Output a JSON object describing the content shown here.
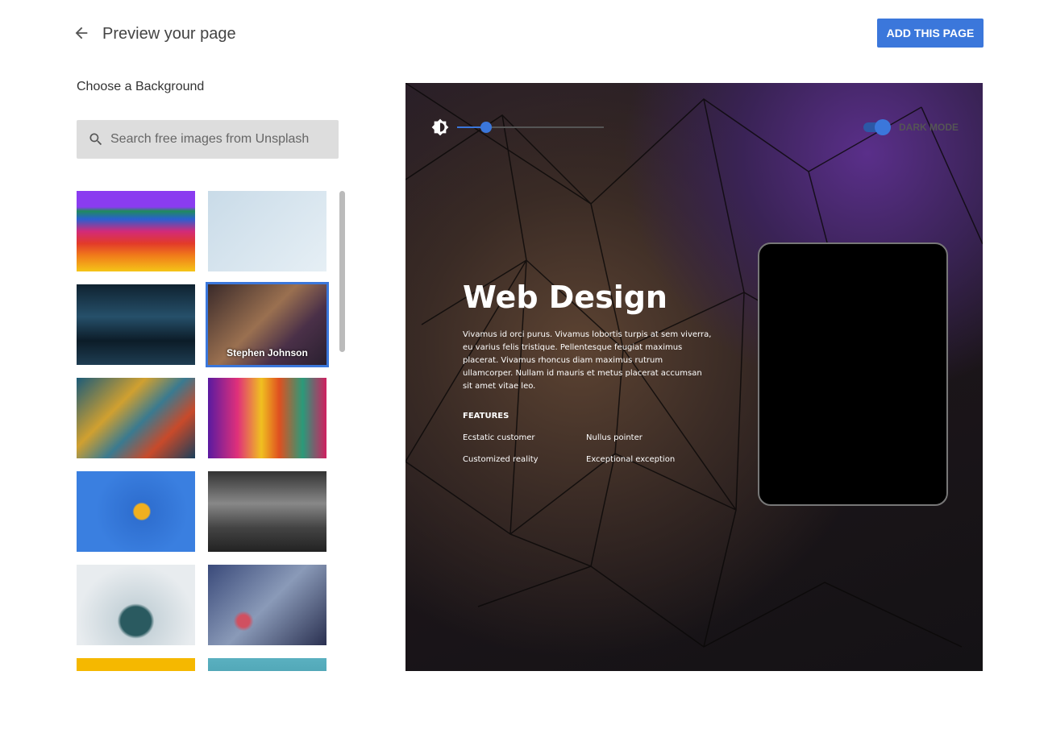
{
  "header": {
    "title": "Preview your page",
    "add_button": "ADD THIS PAGE"
  },
  "sidebar": {
    "heading": "Choose a Background",
    "search_placeholder": "Search free images from Unsplash",
    "thumbnails": [
      {
        "name": "rainbow-arches",
        "bg": "linear-gradient(180deg,#8a3cf0 0 20%,#1f8a5e 25%,#2a5fd0 35%,#d22a7a 50%,#e23a2a 65%,#f07a1a 80%,#f5c518 100%)"
      },
      {
        "name": "glass-building",
        "bg": "linear-gradient(135deg,#c9dbe8,#e6eff5)"
      },
      {
        "name": "dark-blue-waves",
        "bg": "linear-gradient(180deg,#0f2230,#26506a 40%,#0c1c28 70%,#1e3d52)"
      },
      {
        "name": "geodesic-dome",
        "bg": "linear-gradient(135deg,#3a2a2a,#9a7050 45%,#4a3048 70%,#2a2030)",
        "caption": "Stephen Johnson",
        "selected": true
      },
      {
        "name": "abstract-paint",
        "bg": "linear-gradient(135deg,#1c5b78,#d0a030 35%,#3a7a90 55%,#c84a2a 75%,#1a3e5a)"
      },
      {
        "name": "colorful-curves",
        "bg": "linear-gradient(90deg,#5a1aa0,#e0307a 25%,#f0c020 45%,#e05020 60%,#2a9a7a 80%,#d02060)"
      },
      {
        "name": "blue-fruit",
        "bg": "radial-gradient(circle at 55% 50%,#f0b020 0 10%,#2f6fd0 12%,#3a7fe0 60%)"
      },
      {
        "name": "train-station",
        "bg": "linear-gradient(180deg,#333,#888 40%,#444 70%,#222)"
      },
      {
        "name": "ice-house",
        "bg": "radial-gradient(ellipse at 50% 70%,#2a5a60 0 18%,#c8d4da 22%,#e8ecef 70%)"
      },
      {
        "name": "rain-bokeh",
        "bg": "radial-gradient(circle at 30% 70%,#d05060 0 6%,transparent 10%),linear-gradient(135deg,#3a4a7a,#8a9ab8 50%,#2a3050)"
      },
      {
        "name": "yellow",
        "bg": "#f5b800"
      },
      {
        "name": "pool-water",
        "bg": "linear-gradient(180deg,#5ab0c0,#2a8090)"
      }
    ]
  },
  "preview": {
    "brightness": 0.2,
    "dark_mode_label": "DARK MODE",
    "dark_mode": true,
    "heading": "Web Design",
    "paragraph": "Vivamus id orci purus. Vivamus lobortis turpis at sem viverra, eu varius felis tristique. Pellentesque feugiat maximus placerat. Vivamus rhoncus diam maximus rutrum ullamcorper. Nullam id mauris et metus placerat accumsan sit amet vitae leo.",
    "features_label": "FEATURES",
    "features": [
      "Ecstatic customer",
      "Nullus pointer",
      "Customized reality",
      "Exceptional exception"
    ]
  },
  "colors": {
    "accent": "#3b77db"
  }
}
